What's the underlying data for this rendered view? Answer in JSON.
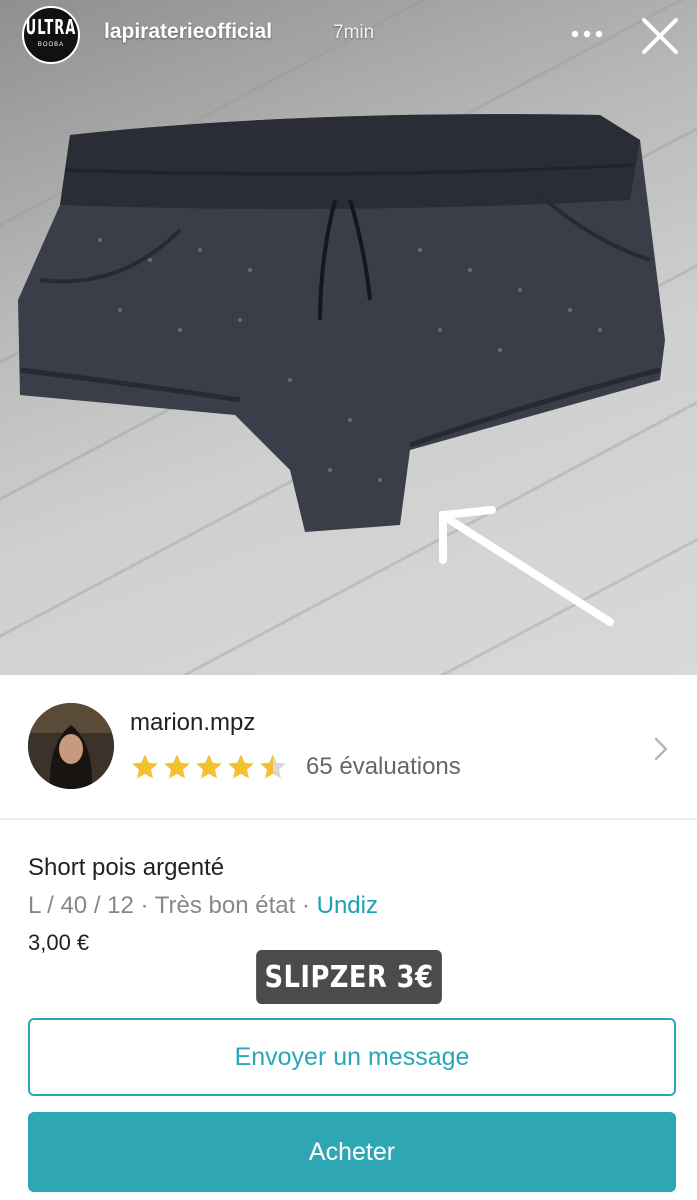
{
  "story": {
    "logo_main": "ULTRA",
    "logo_sub": "BOOBA",
    "username": "lapiraterieofficial",
    "time": "7min"
  },
  "seller": {
    "name": "marion.mpz",
    "rating_stars": 4.5,
    "ratings_count": "65 évaluations"
  },
  "item": {
    "title": "Short pois argenté",
    "meta_prefix": "L / 40 / 12 · Très bon état · ",
    "brand": "Undiz",
    "price": "3,00 €"
  },
  "sticker": {
    "text": "SLIPZER 3€"
  },
  "actions": {
    "message_label": "Envoyer un message",
    "buy_label": "Acheter"
  },
  "colors": {
    "accent": "#2fa6b4",
    "star": "#f2c12e",
    "sticker_bg": "#4b4b4b"
  }
}
